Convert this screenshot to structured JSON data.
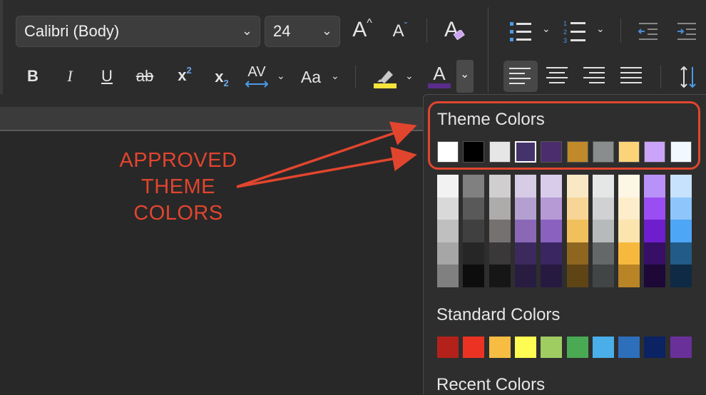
{
  "toolbar": {
    "font_name": "Calibri (Body)",
    "font_size": "24",
    "grow_font": "A",
    "shrink_font": "A",
    "clear_format": "A",
    "bold": "B",
    "italic": "I",
    "underline": "U",
    "strike": "ab",
    "superscript": "x",
    "superscript_sup": "2",
    "subscript": "x",
    "subscript_sub": "2",
    "char_spacing": "AV",
    "change_case": "Aa",
    "font_color": "A",
    "highlight_color": "#f7e43c",
    "font_color_bar": "#5a2d8c"
  },
  "annotation": {
    "lines": [
      "APPROVED",
      "THEME",
      "COLORS"
    ],
    "color": "#e2452e"
  },
  "color_panel": {
    "theme_title": "Theme Colors",
    "standard_title": "Standard Colors",
    "recent_title": "Recent Colors",
    "theme_row": [
      "#ffffff",
      "#000000",
      "#e7e6e6",
      "#44336b",
      "#4b2d6e",
      "#c08a2a",
      "#898d8e",
      "#fbd47a",
      "#caa4f8",
      "#f1f8ff"
    ],
    "theme_grid": [
      [
        "#f2f2f2",
        "#d9d9d9",
        "#bfbfbf",
        "#a6a6a6",
        "#808080"
      ],
      [
        "#808080",
        "#595959",
        "#404040",
        "#262626",
        "#0d0d0d"
      ],
      [
        "#d0cece",
        "#aeabab",
        "#757171",
        "#3a3838",
        "#171616"
      ],
      [
        "#d6cce6",
        "#b3a0d0",
        "#8b68b6",
        "#3c2a5e",
        "#281c40"
      ],
      [
        "#d9ccea",
        "#b69ad6",
        "#8a61bf",
        "#3a2660",
        "#271a41"
      ],
      [
        "#fae8c5",
        "#f6d596",
        "#f1c05c",
        "#8e6620",
        "#5f4415"
      ],
      [
        "#e5e6e6",
        "#cfd1d2",
        "#b7babb",
        "#646868",
        "#424545"
      ],
      [
        "#fef6e4",
        "#fdedca",
        "#fce4af",
        "#f7b93d",
        "#b88425"
      ],
      [
        "#b892f8",
        "#9a4df3",
        "#6e1ecc",
        "#370f66",
        "#1d0838"
      ],
      [
        "#c6e2fd",
        "#8ec6fb",
        "#4ea6f6",
        "#225b87",
        "#0e2a44"
      ]
    ],
    "standard_row": [
      "#b3221a",
      "#ec3323",
      "#f6bd42",
      "#fefb52",
      "#a0cd62",
      "#4aa953",
      "#4aaee9",
      "#2d6fbb",
      "#0b2263",
      "#6a3099"
    ]
  }
}
